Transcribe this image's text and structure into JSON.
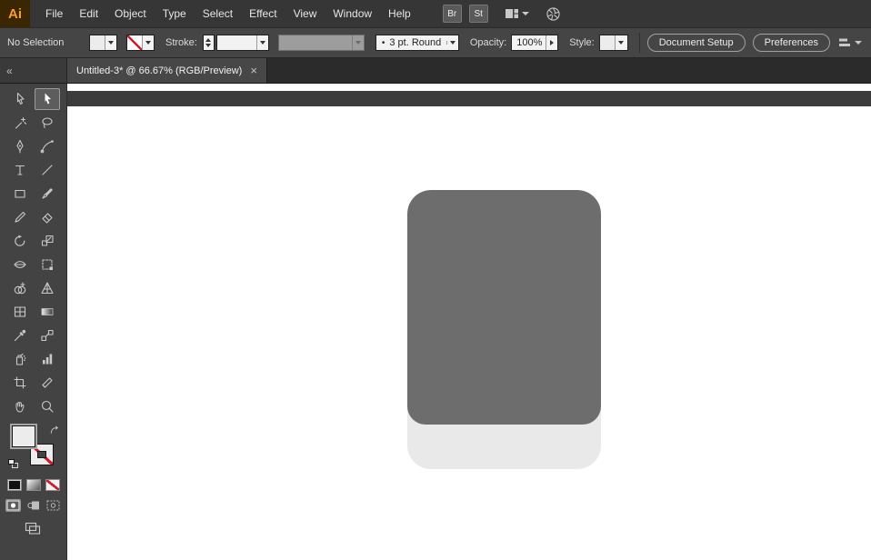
{
  "menu_bar": {
    "logo_text": "Ai",
    "items": [
      "File",
      "Edit",
      "Object",
      "Type",
      "Select",
      "Effect",
      "View",
      "Window",
      "Help"
    ],
    "bridge_label": "Br",
    "stock_label": "St"
  },
  "control_bar": {
    "selection_status": "No Selection",
    "stroke_label": "Stroke:",
    "brush_bullet": "•",
    "brush_value": "3 pt. Round",
    "opacity_label": "Opacity:",
    "opacity_value": "100%",
    "style_label": "Style:",
    "document_setup_label": "Document Setup",
    "preferences_label": "Preferences"
  },
  "tab_bar": {
    "collapse_glyph": "«",
    "document_tab": {
      "title": "Untitled-3* @ 66.67% (RGB/Preview)",
      "close_glyph": "×"
    }
  },
  "toolbar": {
    "active_tool": "selection",
    "tools": [
      "direct-selection",
      "selection",
      "magic-wand",
      "lasso",
      "pen",
      "curvature",
      "type",
      "line-segment",
      "rectangle",
      "paintbrush",
      "shaper",
      "eraser",
      "rotate",
      "scale",
      "width",
      "free-transform",
      "shape-builder",
      "perspective-grid",
      "mesh",
      "gradient",
      "eyedropper",
      "blend",
      "symbol-sprayer",
      "column-graph",
      "artboard",
      "slice",
      "hand",
      "zoom"
    ]
  },
  "canvas": {
    "shape": {
      "body_color": "#6d6d6d",
      "band_color": "#e9e9e9"
    }
  },
  "colors": {
    "none_red": "#d11a2a",
    "logo_orange": "#ff9c2a",
    "artboard_white": "#ffffff"
  }
}
